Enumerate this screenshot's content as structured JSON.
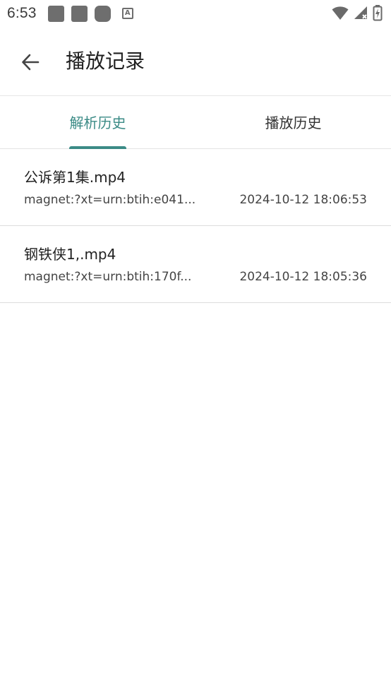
{
  "status_bar": {
    "time": "6:53",
    "icons": [
      "notification-square-icon",
      "notification-square-icon",
      "notification-rounded-icon",
      "font-a-icon",
      "wifi-icon",
      "signal-icon",
      "battery-charging-icon"
    ]
  },
  "app_bar": {
    "title": "播放记录",
    "back_icon": "arrow-left-icon"
  },
  "tabs": [
    {
      "label": "解析历史",
      "active": true
    },
    {
      "label": "播放历史",
      "active": false
    }
  ],
  "colors": {
    "accent": "#3b8b86",
    "divider": "#dcdcdc",
    "text_primary": "#222222",
    "text_secondary": "#444444"
  },
  "history": [
    {
      "title": "公诉第1集.mp4",
      "link": "magnet:?xt=urn:btih:e041...",
      "time": "2024-10-12 18:06:53"
    },
    {
      "title": "钢铁侠1,.mp4",
      "link": "magnet:?xt=urn:btih:170f...",
      "time": "2024-10-12 18:05:36"
    }
  ]
}
